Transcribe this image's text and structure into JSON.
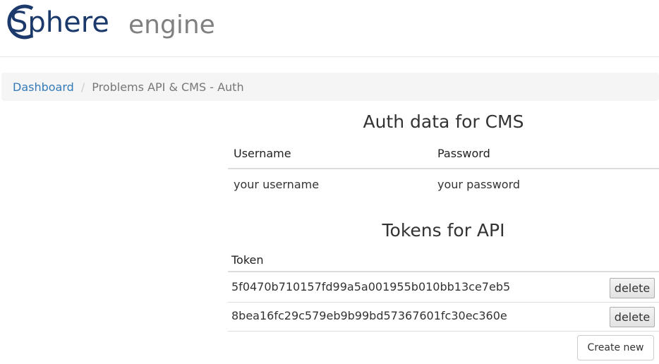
{
  "header": {
    "logo": {
      "word1": "Sphere",
      "word2": "engine",
      "primary_color": "#1b3a6b",
      "secondary_color": "#808080"
    }
  },
  "breadcrumb": {
    "home": "Dashboard",
    "separator": "/",
    "current": "Problems API & CMS - Auth"
  },
  "auth_section": {
    "title": "Auth data for CMS",
    "columns": [
      "Username",
      "Password"
    ],
    "username": "your username",
    "password": "your password"
  },
  "tokens_section": {
    "title": "Tokens for API",
    "column": "Token",
    "tokens": [
      {
        "value": "5f0470b710157fd99a5a001955b010bb13ce7eb5",
        "action": "delete"
      },
      {
        "value": "8bea16fc29c579eb9b99bd57367601fc30ec360e",
        "action": "delete"
      }
    ],
    "create_label": "Create new"
  },
  "colors": {
    "link": "#337ab7",
    "breadcrumb_bg": "#f5f5f5"
  }
}
